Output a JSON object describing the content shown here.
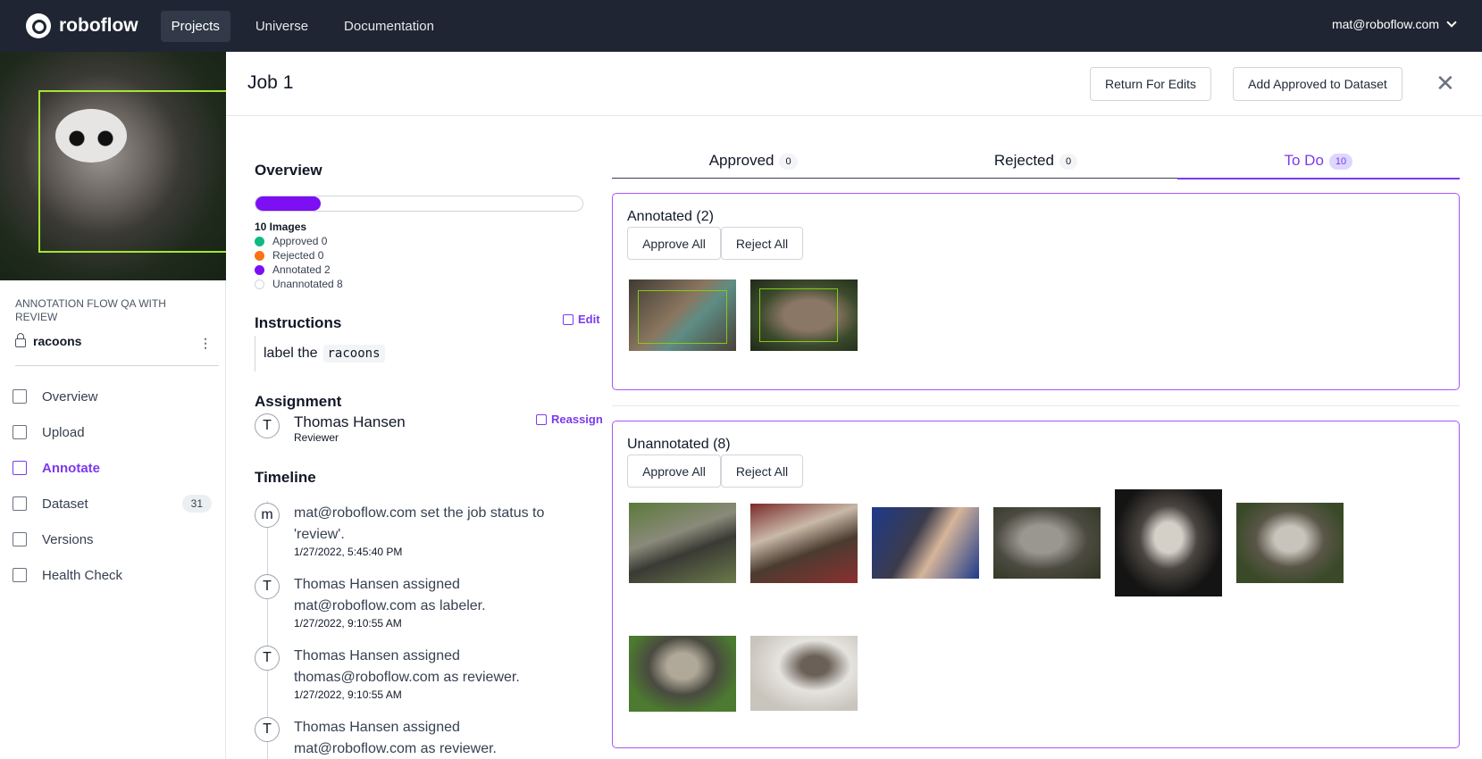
{
  "nav": {
    "brand": "roboflow",
    "links": [
      "Projects",
      "Universe",
      "Documentation"
    ],
    "user": "mat@roboflow.com"
  },
  "sidebar": {
    "project_group": "ANNOTATION FLOW QA WITH REVIEW",
    "project_name": "racoons",
    "items": [
      {
        "label": "Overview",
        "icon": "overview-icon"
      },
      {
        "label": "Upload",
        "icon": "upload-icon"
      },
      {
        "label": "Annotate",
        "icon": "annotate-icon",
        "active": true
      },
      {
        "label": "Dataset",
        "icon": "dataset-icon",
        "count": "31"
      },
      {
        "label": "Versions",
        "icon": "versions-icon"
      },
      {
        "label": "Health Check",
        "icon": "health-check-icon"
      }
    ]
  },
  "header": {
    "title": "Job 1",
    "return_label": "Return For Edits",
    "add_label": "Add Approved to Dataset",
    "close": "✕"
  },
  "overview": {
    "title": "Overview",
    "progress_fraction": 0.2,
    "images_label": "10 Images",
    "stats": [
      {
        "label": "Approved 0",
        "color": "#10b981"
      },
      {
        "label": "Rejected 0",
        "color": "#f97316"
      },
      {
        "label": "Annotated 2",
        "color": "#7c0ff3"
      },
      {
        "label": "Unannotated 8",
        "color": "#ffffff"
      }
    ]
  },
  "instructions": {
    "title": "Instructions",
    "edit_label": "Edit",
    "text": "label the",
    "code": "racoons"
  },
  "assignment": {
    "title": "Assignment",
    "reassign_label": "Reassign",
    "avatar": "T",
    "name": "Thomas Hansen",
    "role": "Reviewer"
  },
  "timeline": {
    "title": "Timeline",
    "events": [
      {
        "avatar": "m",
        "text": "mat@roboflow.com set the job status to 'review'.",
        "time": "1/27/2022, 5:45:40 PM"
      },
      {
        "avatar": "T",
        "text": "Thomas Hansen assigned mat@roboflow.com as labeler.",
        "time": "1/27/2022, 9:10:55 AM"
      },
      {
        "avatar": "T",
        "text": "Thomas Hansen assigned thomas@roboflow.com as reviewer.",
        "time": "1/27/2022, 9:10:55 AM"
      },
      {
        "avatar": "T",
        "text": "Thomas Hansen assigned mat@roboflow.com as reviewer.",
        "time": ""
      }
    ]
  },
  "tabs": [
    {
      "label": "Approved",
      "count": "0"
    },
    {
      "label": "Rejected",
      "count": "0"
    },
    {
      "label": "To Do",
      "count": "10",
      "active": true
    }
  ],
  "annotated": {
    "title": "Annotated (2)",
    "approve_all": "Approve All",
    "reject_all": "Reject All"
  },
  "unannotated": {
    "title": "Unannotated (8)",
    "approve_all": "Approve All",
    "reject_all": "Reject All"
  }
}
